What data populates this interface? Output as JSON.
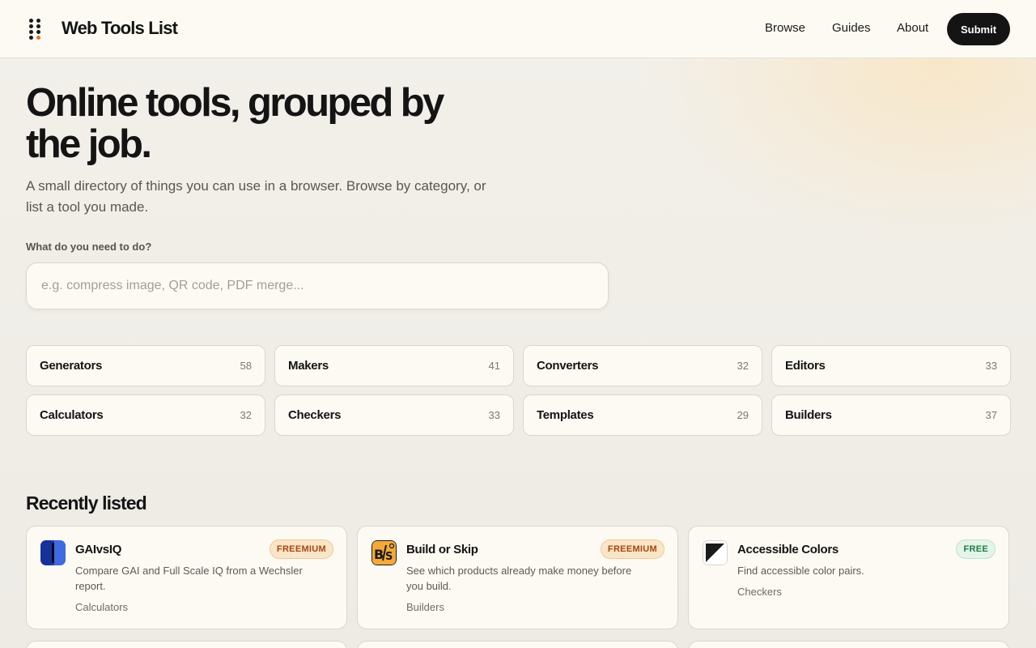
{
  "header": {
    "brand": "Web Tools List",
    "nav": [
      "Browse",
      "Guides",
      "About"
    ],
    "submit_label": "Submit"
  },
  "hero": {
    "title": "Online tools, grouped by the job.",
    "subtitle": "A small directory of things you can use in a browser. Browse by category, or list a tool you made."
  },
  "search": {
    "label": "What do you need to do?",
    "placeholder": "e.g. compress image, QR code, PDF merge..."
  },
  "categories": [
    {
      "name": "Generators",
      "count": "58"
    },
    {
      "name": "Makers",
      "count": "41"
    },
    {
      "name": "Converters",
      "count": "32"
    },
    {
      "name": "Editors",
      "count": "33"
    },
    {
      "name": "Calculators",
      "count": "32"
    },
    {
      "name": "Checkers",
      "count": "33"
    },
    {
      "name": "Templates",
      "count": "29"
    },
    {
      "name": "Builders",
      "count": "37"
    }
  ],
  "recent": {
    "title": "Recently listed",
    "tools": [
      {
        "name": "GAIvsIQ",
        "badge": "FREEMIUM",
        "description": "Compare GAI and Full Scale IQ from a Wechsler report.",
        "category": "Calculators",
        "icon": "gaivsiq-logo"
      },
      {
        "name": "Build or Skip",
        "badge": "FREEMIUM",
        "description": "See which products already make money before you build.",
        "category": "Builders",
        "icon": "build-or-skip-logo"
      },
      {
        "name": "Accessible Colors",
        "badge": "FREE",
        "description": "Find accessible color pairs.",
        "category": "Checkers",
        "icon": "accessible-colors-logo"
      }
    ]
  },
  "colors": {
    "accent": "#e8742a",
    "freemium_badge": "#fbe5c8",
    "free_badge": "#e2f5e8",
    "dark": "#141414"
  }
}
